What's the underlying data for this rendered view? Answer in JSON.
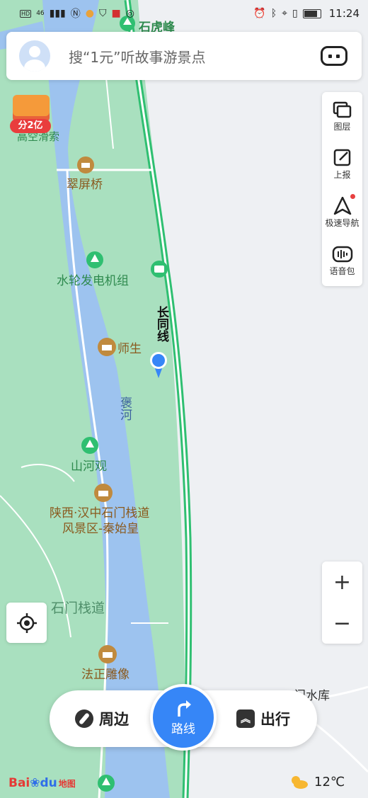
{
  "status_bar": {
    "time": "11:24",
    "network": "46",
    "hd": "HD"
  },
  "search": {
    "placeholder": "搜“1元”听故事游景点"
  },
  "promo_badge": {
    "label": "分2亿"
  },
  "right_panel": {
    "items": [
      {
        "label": "图层",
        "icon": "layers-icon"
      },
      {
        "label": "上报",
        "icon": "report-icon"
      },
      {
        "label": "极速导航",
        "icon": "navigation-icon"
      },
      {
        "label": "语音包",
        "icon": "voice-pack-icon"
      }
    ]
  },
  "zoom": {
    "in_label": "+",
    "out_label": "−"
  },
  "map_labels": {
    "shihufeng": "石虎峰",
    "gaokong": "高空滑索",
    "cuiping": "翠屏桥",
    "shuilun": "水轮发电机组",
    "shisheng": "师生",
    "changtong": "长同线",
    "baohe": "褒河",
    "shanheguan": "山河观",
    "scenic_1": "陕西·汉中石门栈道",
    "scenic_2": "风景区-秦始皇",
    "shimen": "石门栈道",
    "fazheng": "法正雕像",
    "reservoir": "门水库"
  },
  "bottom_bar": {
    "nearby_label": "周边",
    "route_label": "路线",
    "travel_label": "出行"
  },
  "brand": {
    "bai": "Bai",
    "du": "du",
    "map": "地图"
  },
  "weather": {
    "temp": "12℃"
  },
  "colors": {
    "accent": "#3686f7",
    "road_green": "#2fbf71",
    "water": "#9dc3ef",
    "land_green": "#a9e0bf",
    "poi_brown": "#c08a3e"
  }
}
